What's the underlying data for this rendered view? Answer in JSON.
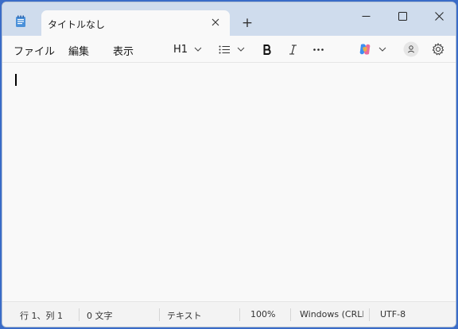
{
  "window": {
    "tab_title": "タイトルなし",
    "new_tab_label": "+"
  },
  "menubar": {
    "file": "ファイル",
    "edit": "編集",
    "view": "表示",
    "heading": "H1"
  },
  "statusbar": {
    "position": "行 1、列 1",
    "char_count": "0 文字",
    "format": "テキスト",
    "zoom": "100%",
    "line_ending": "Windows (CRLF)",
    "encoding": "UTF-8"
  },
  "icons": {
    "app": "notepad-icon",
    "close_tab": "close-icon",
    "minimize": "minimize-icon",
    "maximize": "maximize-icon",
    "close_window": "close-icon",
    "list": "list-icon",
    "bold": "bold-icon",
    "italic": "italic-icon",
    "more": "more-icon",
    "copilot": "copilot-icon",
    "account": "account-icon",
    "settings": "gear-icon"
  },
  "colors": {
    "titlebar": "#cfdced",
    "desktop": "#3a6cc8"
  }
}
